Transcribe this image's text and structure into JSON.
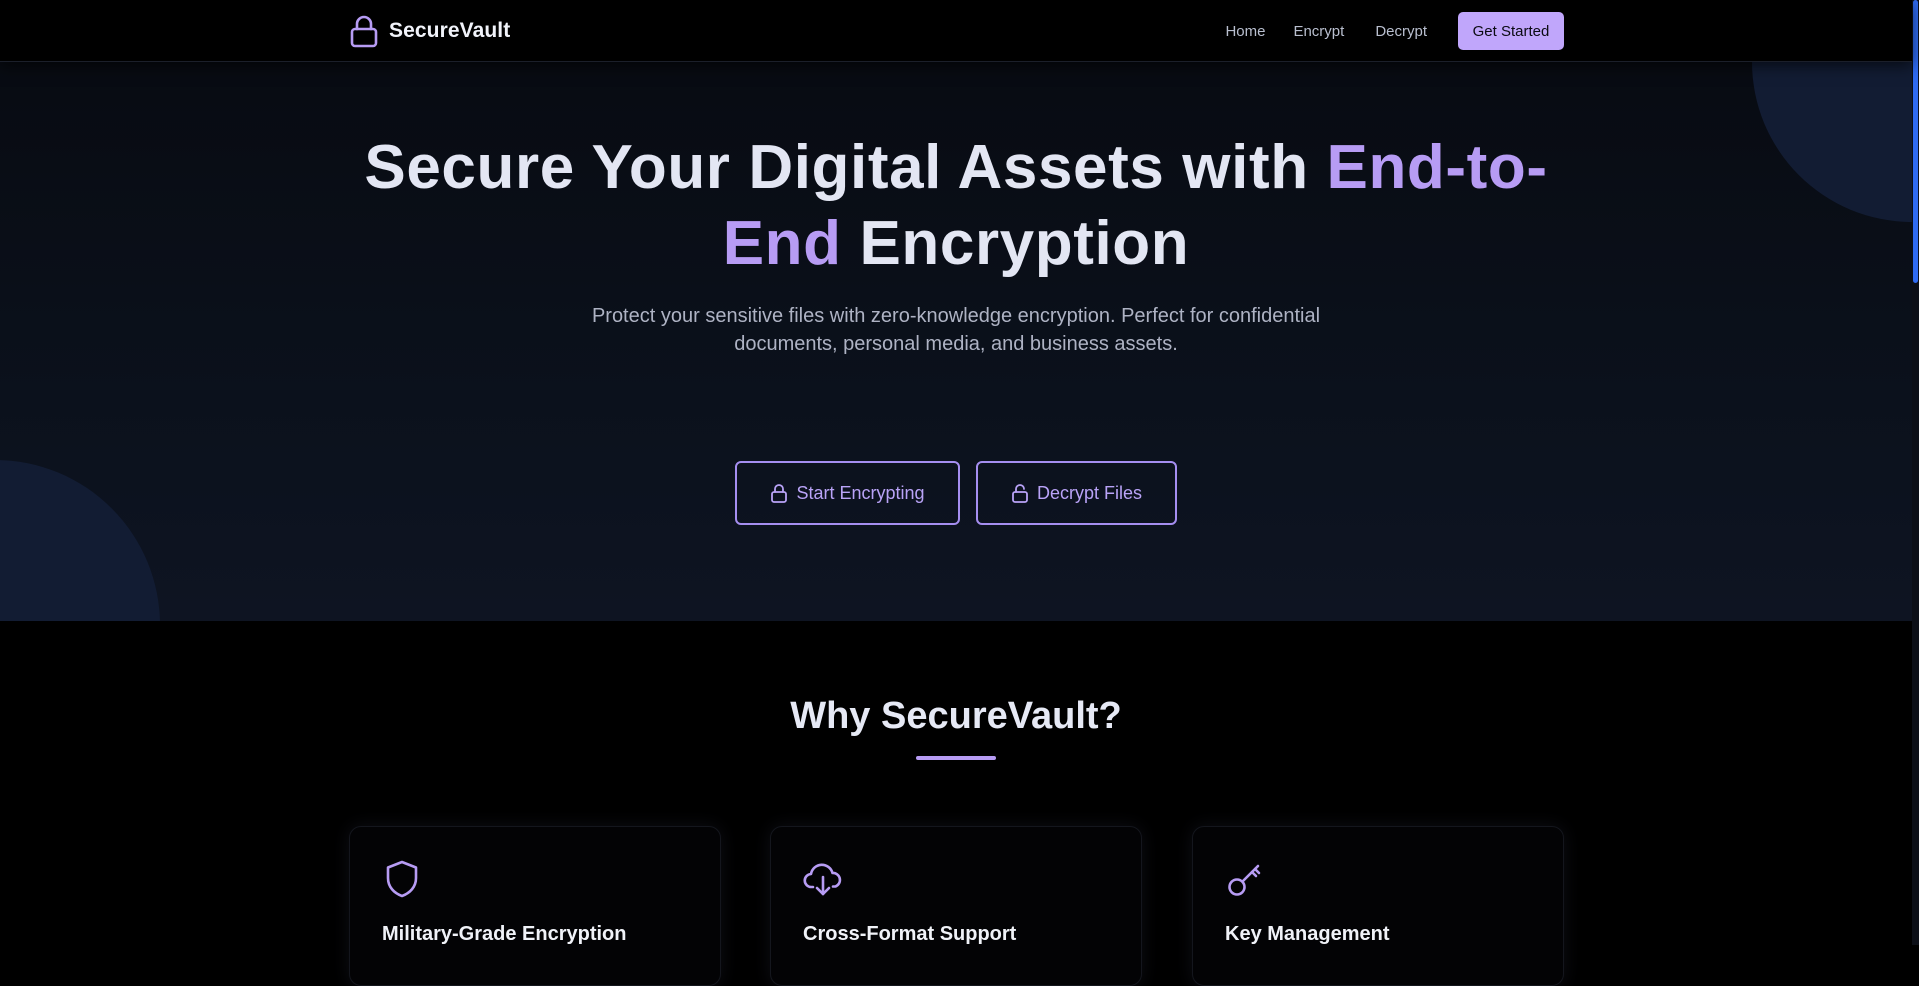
{
  "nav": {
    "brand": "SecureVault",
    "links": [
      "Home",
      "Encrypt",
      "Decrypt"
    ],
    "cta": "Get Started"
  },
  "hero": {
    "title_part1": "Secure Your Digital Assets with ",
    "title_accent": "End-to-End",
    "title_part2": " Encryption",
    "subtitle": "Protect your sensitive files with zero-knowledge encryption. Perfect for confidential documents, personal media, and business assets.",
    "buttons": {
      "encrypt": "Start Encrypting",
      "decrypt": "Decrypt Files"
    }
  },
  "features": {
    "heading": "Why SecureVault?",
    "cards": [
      {
        "icon": "shield-icon",
        "title": "Military-Grade Encryption"
      },
      {
        "icon": "cloud-download-icon",
        "title": "Cross-Format Support"
      },
      {
        "icon": "key-icon",
        "title": "Key Management"
      }
    ]
  },
  "colors": {
    "accent": "#b79cf4",
    "cta_bg": "#c0a6fb",
    "background": "#000000",
    "hero_bg": "#0b111c",
    "scroll_thumb": "#2f6bf2"
  }
}
